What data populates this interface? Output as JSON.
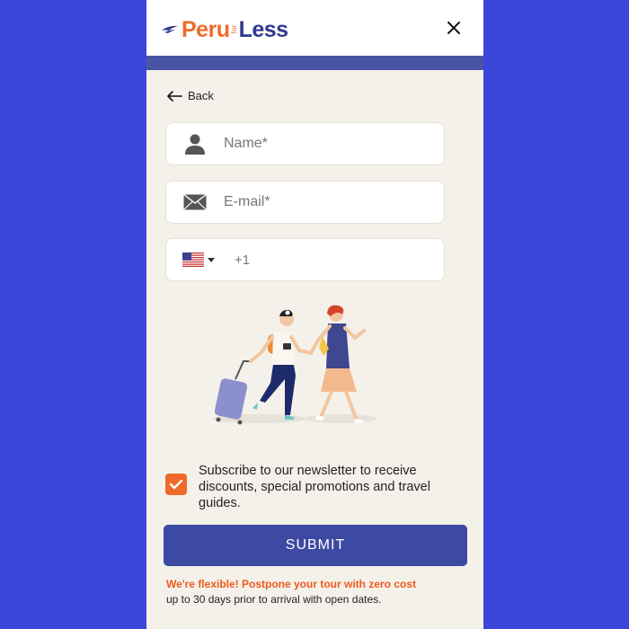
{
  "header": {
    "logo_text_1": "Peru",
    "logo_text_2": "for",
    "logo_text_3": "Less",
    "close_icon": "close-icon"
  },
  "nav": {
    "back_label": "Back"
  },
  "form": {
    "name_placeholder": "Name*",
    "email_placeholder": "E-mail*",
    "phone_country": "US",
    "phone_code": "+1"
  },
  "newsletter": {
    "checked": true,
    "label": "Subscribe to our newsletter to receive discounts, special promotions and travel guides."
  },
  "submit_label": "SUBMIT",
  "footer_note": {
    "title": "We're flexible! Postpone your tour with zero cost",
    "subtitle": "up to 30 days prior to arrival with open dates."
  },
  "colors": {
    "background": "#3a47d9",
    "panel": "#f4f1ea",
    "accent_orange": "#ef6a2a",
    "brand_blue": "#3d4aa3"
  }
}
